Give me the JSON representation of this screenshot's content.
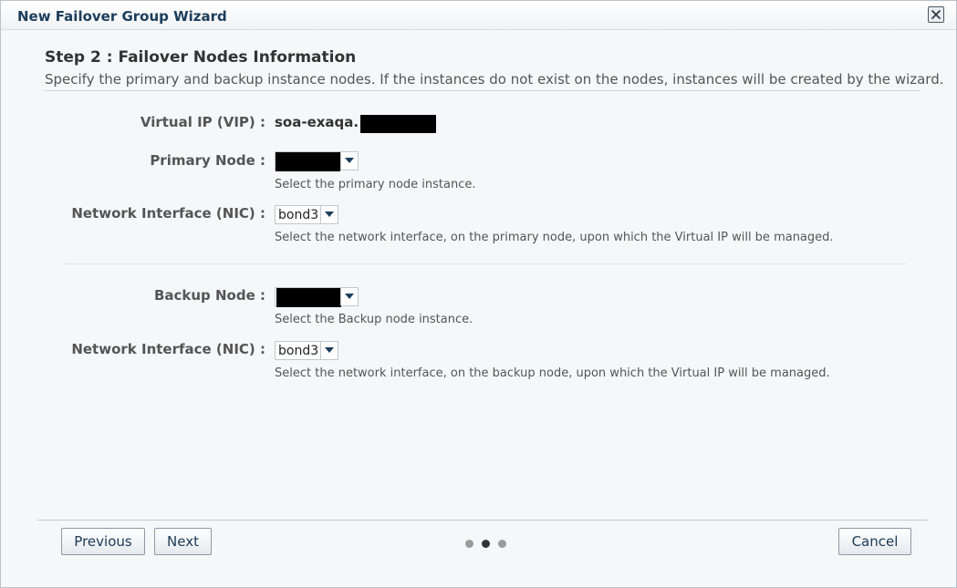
{
  "dialog": {
    "title": "New Failover Group Wizard"
  },
  "step": {
    "title": "Step 2 : Failover Nodes Information",
    "description": "Specify the primary and backup instance nodes. If the instances do not exist on the nodes, instances will be created by the wizard."
  },
  "vip": {
    "label": "Virtual IP (VIP) :",
    "value": "soa-exaqa."
  },
  "primary": {
    "node_label": "Primary Node :",
    "node_hint": "Select the primary node instance.",
    "nic_label": "Network Interface (NIC) :",
    "nic_value": "bond3",
    "nic_hint": "Select the network interface, on the primary node, upon which the Virtual IP will be managed."
  },
  "backup": {
    "node_label": "Backup Node :",
    "node_hint": "Select the Backup node instance.",
    "nic_label": "Network Interface (NIC) :",
    "nic_value": "bond3",
    "nic_hint": "Select the network interface, on the backup node, upon which the Virtual IP will be managed."
  },
  "footer": {
    "previous_label": "Previous",
    "next_label": "Next",
    "cancel_label": "Cancel",
    "train": {
      "total_steps": 3,
      "current_step": 2
    }
  },
  "colors": {
    "title_text": "#1c3d5c",
    "button_text": "#1b3a57",
    "dot_active": "#333333",
    "dot_inactive": "#9a9a9a"
  },
  "icons": {
    "close": "close-icon",
    "dropdown": "chevron-down-icon"
  }
}
